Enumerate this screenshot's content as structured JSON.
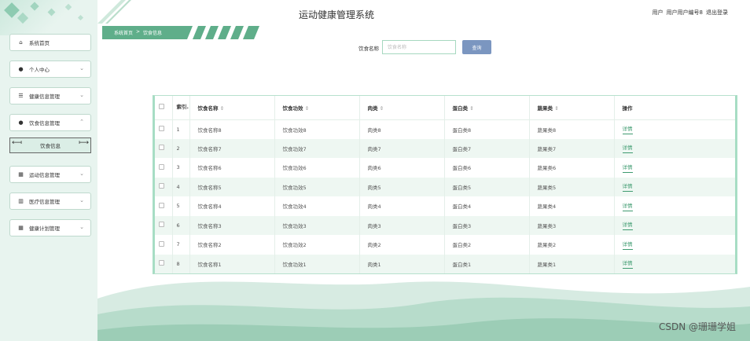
{
  "header": {
    "title": "运动健康管理系统",
    "user_label": "用户",
    "username": "用户用户编号8",
    "logout": "退出登录"
  },
  "breadcrumb": {
    "home": "系统首页",
    "sep": ">",
    "current": "饮食信息"
  },
  "sidebar": {
    "items": [
      {
        "label": "系统首页",
        "icon": "home-icon",
        "glyph": "⌂"
      },
      {
        "label": "个人中心",
        "icon": "user-icon",
        "glyph": "👤"
      },
      {
        "label": "健康信息管理",
        "icon": "sliders-icon",
        "glyph": "☰"
      },
      {
        "label": "饮食信息管理",
        "icon": "user-icon",
        "glyph": "👤"
      },
      {
        "label": "饮食信息",
        "icon": "",
        "glyph": ""
      },
      {
        "label": "运动信息管理",
        "icon": "grid-icon",
        "glyph": "▦"
      },
      {
        "label": "医疗信息管理",
        "icon": "bar-chart-icon",
        "glyph": "▥"
      },
      {
        "label": "健康计划管理",
        "icon": "grid-icon",
        "glyph": "▦"
      }
    ]
  },
  "search": {
    "label": "饮食名称",
    "placeholder": "饮食名称",
    "button": "查询"
  },
  "table": {
    "headers": {
      "index": "索引.",
      "name": "饮食名称",
      "effect": "饮食功效",
      "meat": "肉类",
      "protein": "蛋白类",
      "veg": "蔬果类",
      "action": "操作"
    },
    "sort_glyph": "⇕",
    "detail_label": "详情",
    "rows": [
      {
        "index": "1",
        "name": "饮食名称8",
        "effect": "饮食功效8",
        "meat": "肉类8",
        "protein": "蛋白类8",
        "veg": "蔬果类8"
      },
      {
        "index": "2",
        "name": "饮食名称7",
        "effect": "饮食功效7",
        "meat": "肉类7",
        "protein": "蛋白类7",
        "veg": "蔬果类7"
      },
      {
        "index": "3",
        "name": "饮食名称6",
        "effect": "饮食功效6",
        "meat": "肉类6",
        "protein": "蛋白类6",
        "veg": "蔬果类6"
      },
      {
        "index": "4",
        "name": "饮食名称5",
        "effect": "饮食功效5",
        "meat": "肉类5",
        "protein": "蛋白类5",
        "veg": "蔬果类5"
      },
      {
        "index": "5",
        "name": "饮食名称4",
        "effect": "饮食功效4",
        "meat": "肉类4",
        "protein": "蛋白类4",
        "veg": "蔬果类4"
      },
      {
        "index": "6",
        "name": "饮食名称3",
        "effect": "饮食功效3",
        "meat": "肉类3",
        "protein": "蛋白类3",
        "veg": "蔬果类3"
      },
      {
        "index": "7",
        "name": "饮食名称2",
        "effect": "饮食功效2",
        "meat": "肉类2",
        "protein": "蛋白类2",
        "veg": "蔬果类2"
      },
      {
        "index": "8",
        "name": "饮食名称1",
        "effect": "饮食功效1",
        "meat": "肉类1",
        "protein": "蛋白类1",
        "veg": "蔬果类1"
      }
    ]
  },
  "watermark": "CSDN @珊珊学姐",
  "colors": {
    "accent": "#3f9b70",
    "sidebar_bg": "#e8f4ef",
    "button": "#7b96c0",
    "crumb_bar": "#5fae8a"
  }
}
